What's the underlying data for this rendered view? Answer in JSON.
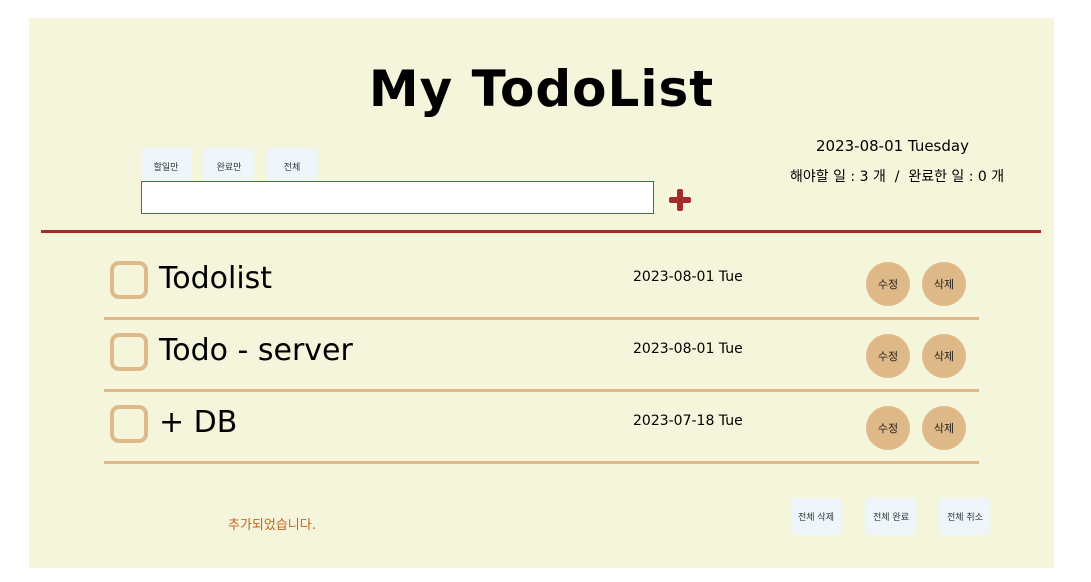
{
  "header": {
    "title": "My TodoList",
    "date": "2023-08-01 Tuesday",
    "counts": "해야할 일 : 3 개  /  완료한 일 : 0 개"
  },
  "filters": [
    {
      "label": "할일만"
    },
    {
      "label": "완료만"
    },
    {
      "label": "전체"
    }
  ],
  "input": {
    "value": "",
    "placeholder": ""
  },
  "add_icon": "plus-icon",
  "todos": [
    {
      "text": "Todolist",
      "date": "2023-08-01 Tue",
      "done": false,
      "edit": "수정",
      "delete": "삭제"
    },
    {
      "text": "Todo - server",
      "date": "2023-08-01 Tue",
      "done": false,
      "edit": "수정",
      "delete": "삭제"
    },
    {
      "text": "+ DB",
      "date": "2023-07-18 Tue",
      "done": false,
      "edit": "수정",
      "delete": "삭제"
    }
  ],
  "status": {
    "message": "추가되었습니다."
  },
  "bulk_actions": [
    {
      "label": "전체 삭제"
    },
    {
      "label": "전체 완료"
    },
    {
      "label": "전체 취소"
    }
  ],
  "colors": {
    "background": "#f5f5dc",
    "accent": "#a52a2a",
    "item": "#deb887",
    "status": "#c8641e",
    "button": "#eef6fb"
  }
}
